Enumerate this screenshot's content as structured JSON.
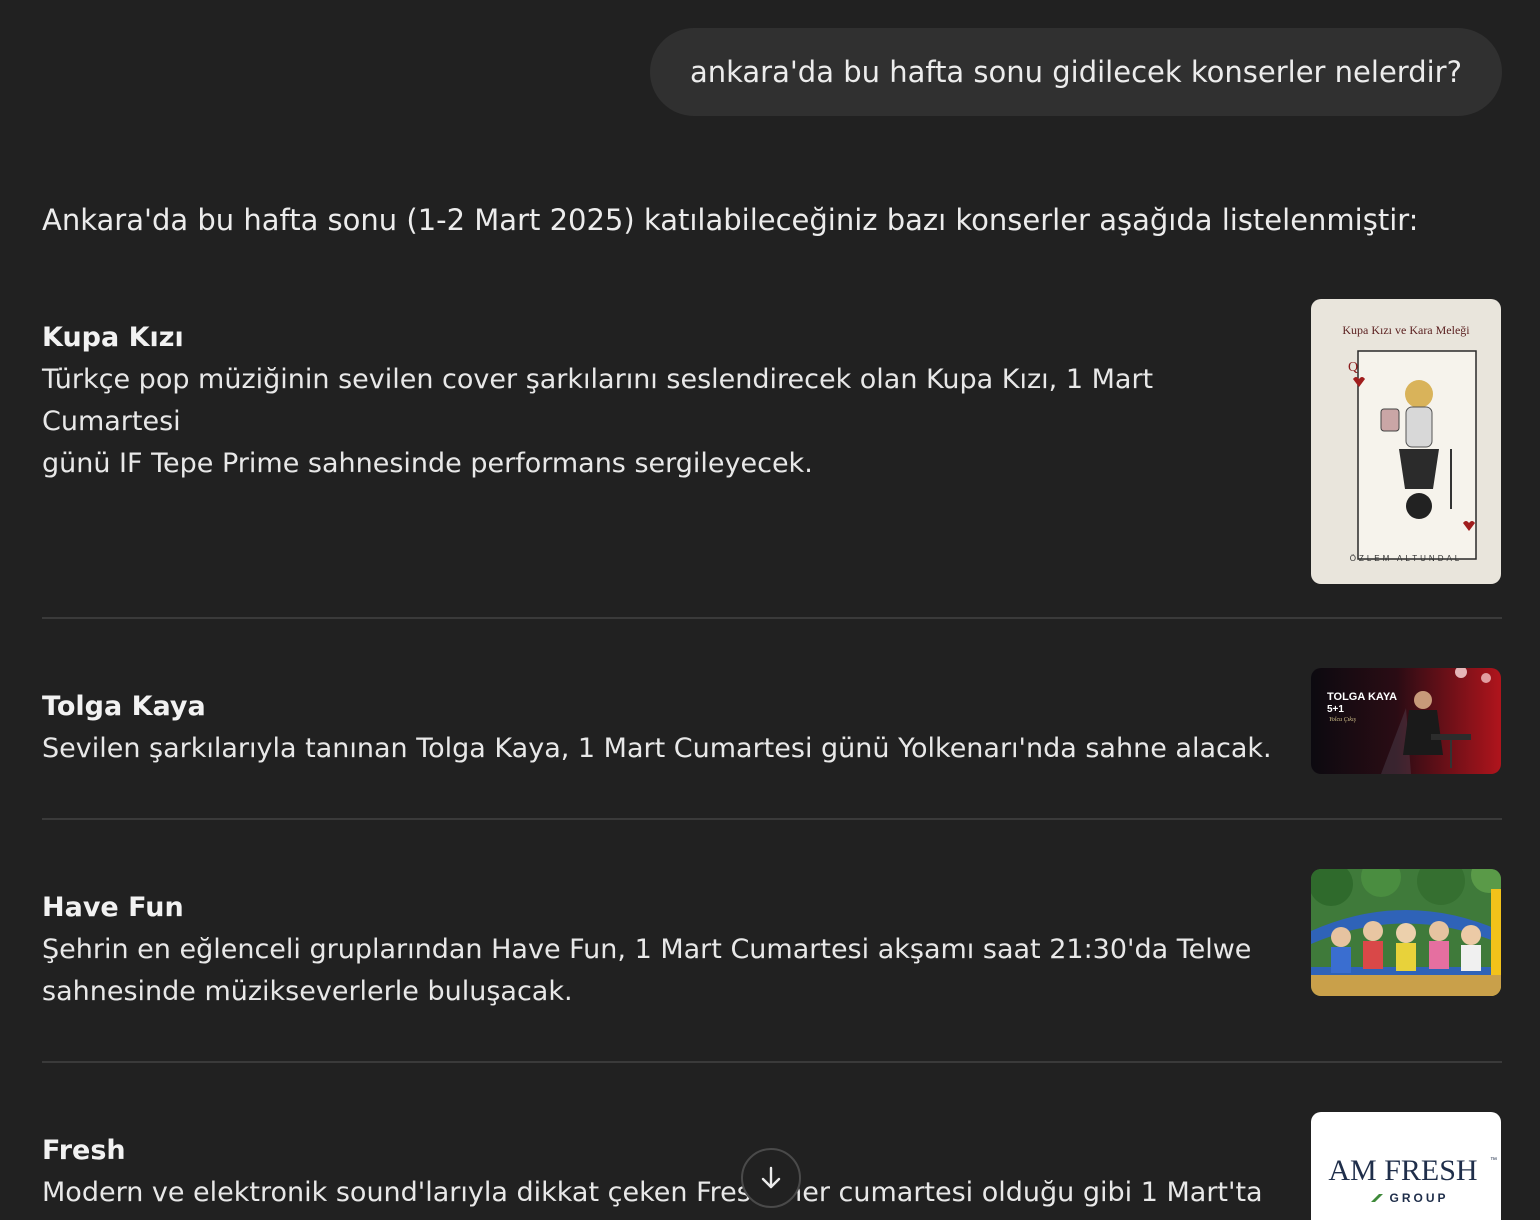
{
  "user_message": "ankara'da bu hafta sonu gidilecek konserler nelerdir?",
  "intro": "Ankara'da bu hafta sonu (1-2 Mart 2025) katılabileceğiniz bazı konserler aşağıda listelenmiştir:",
  "items": [
    {
      "title": "Kupa Kızı",
      "desc_lines": [
        "Türkçe pop müziğinin sevilen cover şarkılarını seslendirecek olan Kupa Kızı, 1 Mart Cumartesi",
        "günü IF Tepe Prime sahnesinde performans sergileyecek."
      ],
      "image_text": {
        "title": "Kupa Kızı ve Kara Meleği",
        "artist": "ÖZLEM ALTUNDAL",
        "card_rank": "Q"
      }
    },
    {
      "title": "Tolga Kaya",
      "desc_lines": [
        "Sevilen şarkılarıyla tanınan Tolga Kaya, 1 Mart Cumartesi günü Yolkenarı'nda sahne alacak."
      ],
      "image_text": {
        "name": "TOLGA KAYA",
        "sub": "5+1",
        "script": "Yolcu Çıkış"
      }
    },
    {
      "title": "Have Fun",
      "desc_lines": [
        "Şehrin en eğlenceli gruplarından Have Fun, 1 Mart Cumartesi akşamı saat 21:30'da Telwe",
        "sahnesinde müzikseverlerle buluşacak."
      ]
    },
    {
      "title": "Fresh",
      "desc_lines": [
        "Modern ve elektronik sound'larıyla dikkat çeken Fresh, her cumartesi olduğu gibi 1 Mart'ta da"
      ],
      "image_text": {
        "logo": "AM FRESH",
        "tm": "™",
        "group": "GROUP"
      }
    }
  ],
  "colors": {
    "background": "#212121",
    "bubble": "#303030",
    "text": "#ececec",
    "divider": "#3a3a3a"
  },
  "icons": {
    "scroll_down": "arrow-down-icon"
  }
}
